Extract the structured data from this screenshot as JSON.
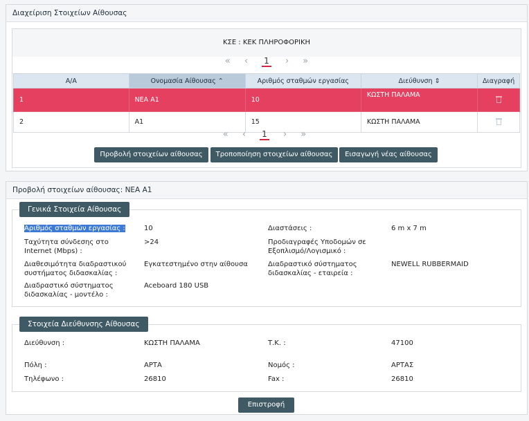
{
  "panel1": {
    "title": "Διαχείριση Στοιχείων Αίθουσας",
    "kse": "ΚΣΕ : ΚΕΚ ΠΛΗΡΟΦΟΡΙΚΗ",
    "pager": {
      "first": "«",
      "prev": "‹",
      "page": "1",
      "next": "›",
      "last": "»"
    },
    "columns": [
      "Α/Α",
      "Ονομασία Αίθουσας",
      "Αριθμός σταθμών εργασίας",
      "Διεύθυνση",
      "Διαγραφή"
    ],
    "rows": [
      {
        "aa": "1",
        "name": "ΝΕΑ Α1",
        "stations": "10",
        "address": "ΚΩΣΤΗ ΠΑΛΑΜΑ"
      },
      {
        "aa": "2",
        "name": "Α1",
        "stations": "15",
        "address": "ΚΩΣΤΗ ΠΑΛΑΜΑ"
      }
    ],
    "buttons": {
      "view": "Προβολή στοιχείων αίθουσας",
      "edit": "Τροποποίηση στοιχείων αίθουσας",
      "add": "Εισαγωγή νέας αίθουσας"
    }
  },
  "panel2": {
    "title": "Προβολή στοιχείων αίθουσας: ΝΕΑ Α1",
    "general": {
      "tab": "Γενικά Στοιχεία Αίθουσας",
      "stations_label": "Αριθμός σταθμών εργασίας :",
      "stations_value": "10",
      "dimensions_label": "Διαστάσεις :",
      "dimensions_value": "6 m x 7 m",
      "speed_label_1": "Ταχύτητα σύνδεσης στο",
      "speed_label_2": "Internet (Mbps) :",
      "speed_value": ">24",
      "specs_label_1": "Προδιαγραφές Υποδομών σε",
      "specs_label_2": "Εξοπλισμό/Λογισμικό :",
      "avail_label_1": "Διαθεσιμότητα διαδραστικού",
      "avail_label_2": "συστήματος διδασκαλίας :",
      "avail_value": "Εγκατεστημένο στην αίθουσα",
      "company_label_1": "Διαδραστικό σύστηματος",
      "company_label_2": "διδασκαλίας - εταιρεία :",
      "company_value": "NEWELL RUBBERMAID",
      "model_label_1": "Διαδραστικό σύστηματος",
      "model_label_2": "διδασκαλίας - μοντέλο :",
      "model_value": "Aceboard 180 USB"
    },
    "address": {
      "tab": "Στοιχεία Διεύθυνσης Αίθουσας",
      "street_label": "Διεύθυνση :",
      "street_value": "ΚΩΣΤΗ ΠΑΛΑΜΑ",
      "zip_label": "Τ.Κ. :",
      "zip_value": "47100",
      "city_label": "Πόλη :",
      "city_value": "ΑΡΤΑ",
      "prefecture_label": "Νομός :",
      "prefecture_value": "ΑΡΤΑΣ",
      "phone_label": "Τηλέφωνο :",
      "phone_value": "26810",
      "fax_label": "Fax :",
      "fax_value": "26810"
    },
    "back_button": "Επιστροφή"
  },
  "colors": {
    "accent": "#3f5a65",
    "selected_row": "#e5405f",
    "header": "#dce6f0"
  }
}
